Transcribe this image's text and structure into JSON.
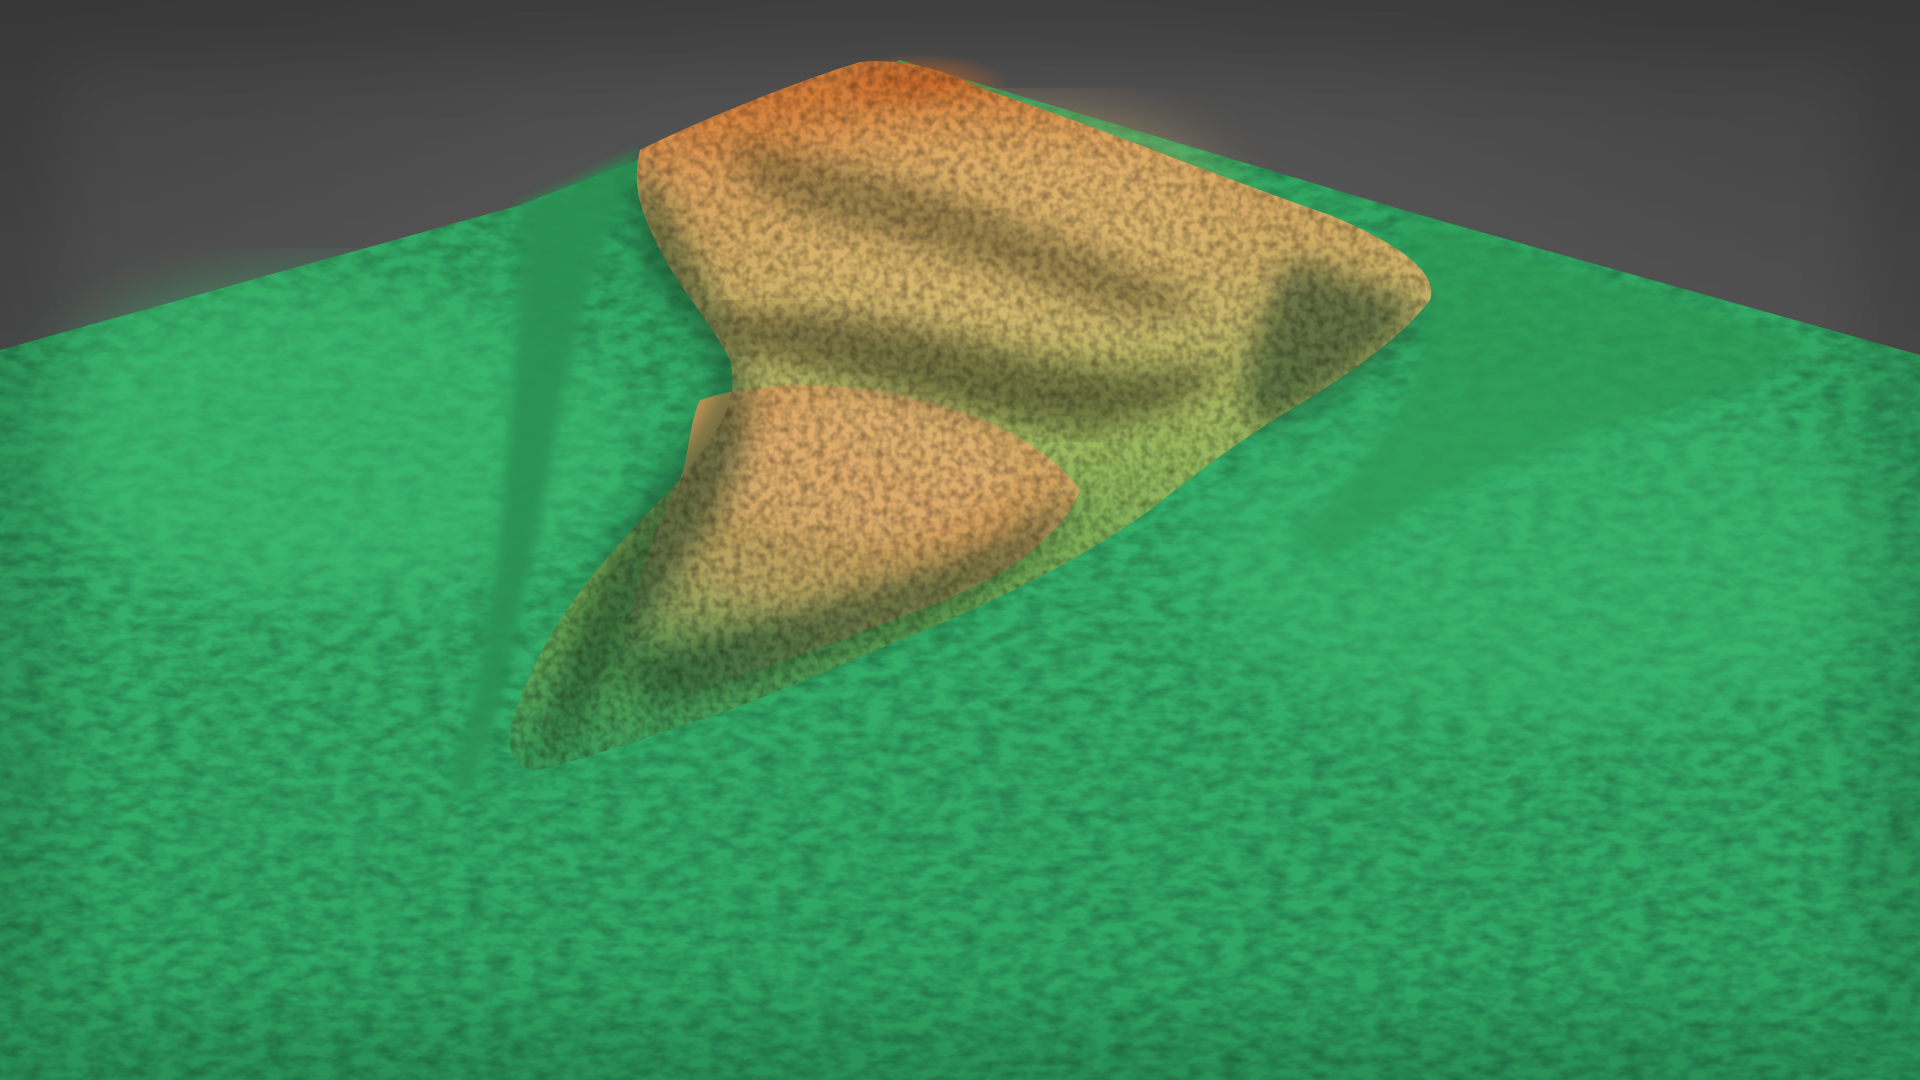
{
  "scene": {
    "kind": "3d-terrain-elevation-model",
    "labels": [],
    "colors": {
      "background_top": "#3f3f3f",
      "background_bottom": "#6e6e6e",
      "lowland_green": "#2fa862",
      "lowland_green_light": "#3cbb70",
      "mid_green": "#7fb257",
      "yellow": "#d8c070",
      "tan": "#d6a865",
      "orange": "#d9863c",
      "peak_orange": "#c86a2a",
      "shadow": "#1f5a33"
    }
  }
}
